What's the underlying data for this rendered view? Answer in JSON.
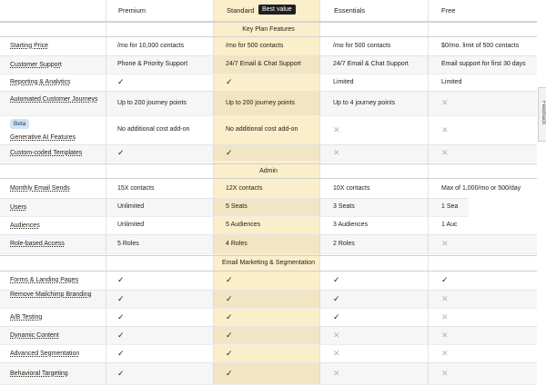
{
  "columns": [
    {
      "label": "Premium"
    },
    {
      "label": "Standard",
      "badge": "Best value"
    },
    {
      "label": "Essentials"
    },
    {
      "label": "Free"
    }
  ],
  "sections": [
    {
      "title": "Key Plan Features",
      "rows": [
        {
          "feature": "Starting Price",
          "values": [
            "/mo for 10,000 contacts",
            "/mo for 500 contacts",
            "/mo for 500 contacts",
            "$0/mo. limit of 500 contacts"
          ]
        },
        {
          "feature": "Customer Support",
          "values": [
            "Phone & Priority Support",
            "24/7 Email & Chat Support",
            "24/7 Email & Chat Support",
            "Email support for first 30 days"
          ]
        },
        {
          "feature": "Reporting & Analytics",
          "values": [
            "check",
            "check",
            "Limited",
            "Limited"
          ]
        },
        {
          "feature": "Automated Customer Journeys",
          "values": [
            "Up to 200 journey points",
            "Up to 200 journey points",
            "Up to 4 journey points",
            "x"
          ]
        },
        {
          "feature": "Generative AI Features",
          "badge": "Beta",
          "values": [
            "No additional cost add-on",
            "No additional cost add-on",
            "x",
            "x"
          ]
        },
        {
          "feature": "Custom-coded Templates",
          "values": [
            "check",
            "check",
            "x",
            "x"
          ]
        }
      ]
    },
    {
      "title": "Admin",
      "rows": [
        {
          "feature": "Monthly Email Sends",
          "values": [
            "15X contacts",
            "12X contacts",
            "10X contacts",
            "Max of 1,000/mo or 500/day"
          ]
        },
        {
          "feature": "Users",
          "values": [
            "Unlimited",
            "5 Seats",
            "3 Seats",
            "1 Sea"
          ]
        },
        {
          "feature": "Audiences",
          "values": [
            "Unlimited",
            "5 Audiences",
            "3 Audiences",
            "1 Auc"
          ]
        },
        {
          "feature": "Role-based Access",
          "values": [
            "5 Roles",
            "4 Roles",
            "2 Roles",
            "x"
          ]
        }
      ]
    },
    {
      "title": "Email Marketing & Segmentation",
      "rows": [
        {
          "feature": "Forms & Landing Pages",
          "values": [
            "check",
            "check",
            "check",
            "check"
          ]
        },
        {
          "feature": "Remove Mailchimp Branding",
          "values": [
            "check",
            "check",
            "check",
            "x"
          ]
        },
        {
          "feature": "A/B Testing",
          "values": [
            "check",
            "check",
            "check",
            "x"
          ]
        },
        {
          "feature": "Dynamic Content",
          "values": [
            "check",
            "check",
            "x",
            "x"
          ]
        },
        {
          "feature": "Advanced Segmentation",
          "values": [
            "check",
            "check",
            "x",
            "x"
          ]
        },
        {
          "feature": "Behavioral Targeting",
          "values": [
            "check",
            "check",
            "x",
            "x"
          ]
        }
      ]
    }
  ],
  "feedback_tab": {
    "label": "Feedback"
  },
  "colors": {
    "standard_highlight": "#fbeecb",
    "text": "#241c15",
    "badge_bg": "#1f1f1f",
    "beta_bg": "#cfe3f5"
  }
}
